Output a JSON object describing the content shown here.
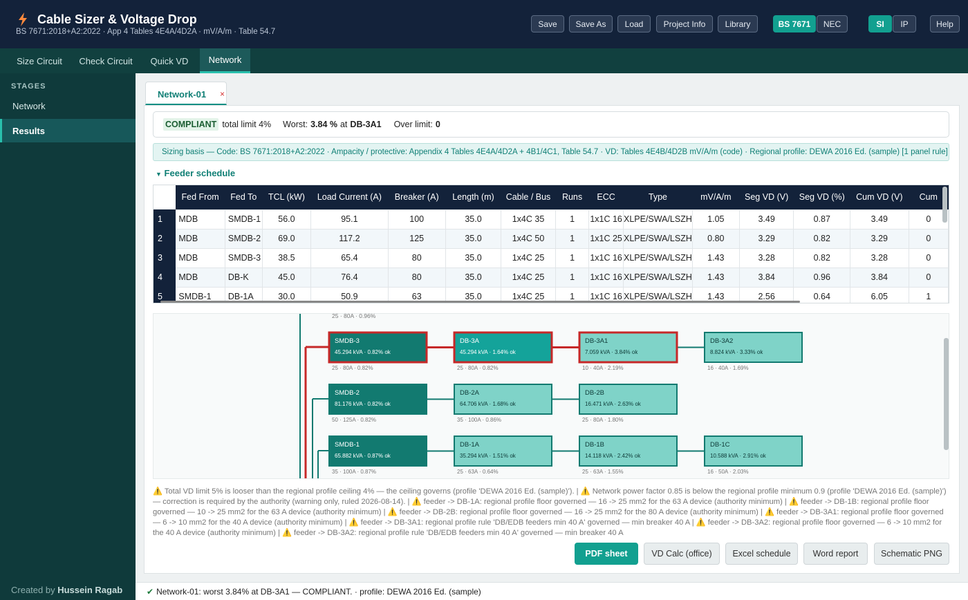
{
  "app": {
    "title": "Cable Sizer & Voltage Drop",
    "subtitle": "BS 7671:2018+A2:2022  ·  App 4 Tables 4E4A/4D2A  ·  mV/A/m  ·  Table 54.7",
    "accent_color": "#12a090",
    "logo_icon": "lightning-icon"
  },
  "toolbar": {
    "save": "Save",
    "save_as": "Save As",
    "load": "Load",
    "project_info": "Project Info",
    "library": "Library",
    "std_bs": "BS 7671",
    "std_nec": "NEC",
    "unit_si": "SI",
    "unit_ip": "IP",
    "help": "Help",
    "selected_standard": "BS 7671",
    "selected_units": "SI"
  },
  "nav_tabs": [
    "Size Circuit",
    "Check Circuit",
    "Quick VD",
    "Network"
  ],
  "active_tab": "Network",
  "sidebar": {
    "heading": "STAGES",
    "items": [
      "Network",
      "Results"
    ],
    "active": "Results",
    "credit_prefix": "Created by",
    "credit_name": "Hussein Ragab"
  },
  "doc_tab": {
    "label": "Network-01",
    "close": "×"
  },
  "summary": {
    "badge": "COMPLIANT",
    "limit": "total limit 4%",
    "worst_label": "Worst:",
    "worst_value": "3.84 %",
    "worst_at": "at",
    "worst_node": "DB-3A1",
    "over_label": "Over limit:",
    "over_value": "0"
  },
  "sizing_basis": "Sizing basis —  Code: BS 7671:2018+A2:2022   ·   Ampacity / protective: Appendix 4 Tables 4E4A/4D2A + 4B1/4C1, Table 54.7   ·   VD: Tables 4E4B/4D2B mV/A/m (code)   ·   Regional profile: DEWA 2016 Ed. (sample) [1 panel rule]",
  "feeder_schedule": {
    "heading": "Feeder schedule",
    "columns": [
      "Fed From",
      "Fed To",
      "TCL (kW)",
      "Load Current (A)",
      "Breaker (A)",
      "Length (m)",
      "Cable / Bus",
      "Runs",
      "ECC",
      "Type",
      "mV/A/m",
      "Seg VD (V)",
      "Seg VD (%)",
      "Cum VD (V)",
      "Cum"
    ],
    "rows": [
      [
        "1",
        "MDB",
        "SMDB-1",
        "56.0",
        "95.1",
        "100",
        "35.0",
        "1x4C 35",
        "1",
        "1x1C 16",
        "XLPE/SWA/LSZH",
        "1.05",
        "3.49",
        "0.87",
        "3.49",
        "0"
      ],
      [
        "2",
        "MDB",
        "SMDB-2",
        "69.0",
        "117.2",
        "125",
        "35.0",
        "1x4C 50",
        "1",
        "1x1C 25",
        "XLPE/SWA/LSZH",
        "0.80",
        "3.29",
        "0.82",
        "3.29",
        "0"
      ],
      [
        "3",
        "MDB",
        "SMDB-3",
        "38.5",
        "65.4",
        "80",
        "35.0",
        "1x4C 25",
        "1",
        "1x1C 16",
        "XLPE/SWA/LSZH",
        "1.43",
        "3.28",
        "0.82",
        "3.28",
        "0"
      ],
      [
        "4",
        "MDB",
        "DB-K",
        "45.0",
        "76.4",
        "80",
        "35.0",
        "1x4C 25",
        "1",
        "1x1C 16",
        "XLPE/SWA/LSZH",
        "1.43",
        "3.84",
        "0.96",
        "3.84",
        "0"
      ],
      [
        "5",
        "SMDB-1",
        "DB-1A",
        "30.0",
        "50.9",
        "63",
        "35.0",
        "1x4C 25",
        "1",
        "1x1C 16",
        "XLPE/SWA/LSZH",
        "1.43",
        "2.56",
        "0.64",
        "6.05",
        "1"
      ]
    ]
  },
  "diagram": {
    "top_label": "25 · 80A · 0.96%",
    "nodes": [
      {
        "name": "SMDB-3",
        "info": "45.294 kVA · 0.82% ok",
        "foot": "25 · 80A · 0.82%",
        "style": "dark",
        "critical": true
      },
      {
        "name": "DB-3A",
        "info": "45.294 kVA · 1.64% ok",
        "foot": "25 · 80A · 0.82%",
        "style": "mid",
        "critical": true
      },
      {
        "name": "DB-3A1",
        "info": "7.059 kVA · 3.84% ok",
        "foot": "10 · 40A · 2.19%",
        "style": "light",
        "critical": true
      },
      {
        "name": "DB-3A2",
        "info": "8.824 kVA · 3.33% ok",
        "foot": "16 · 40A · 1.69%",
        "style": "light",
        "critical": false
      },
      {
        "name": "SMDB-2",
        "info": "81.176 kVA · 0.82% ok",
        "foot": "50 · 125A · 0.82%",
        "style": "dark",
        "critical": false
      },
      {
        "name": "DB-2A",
        "info": "64.706 kVA · 1.68% ok",
        "foot": "35 · 100A · 0.86%",
        "style": "light",
        "critical": false
      },
      {
        "name": "DB-2B",
        "info": "16.471 kVA · 2.63% ok",
        "foot": "25 · 80A · 1.80%",
        "style": "light",
        "critical": false
      },
      {
        "name": "SMDB-1",
        "info": "65.882 kVA · 0.87% ok",
        "foot": "35 · 100A · 0.87%",
        "style": "dark",
        "critical": false
      },
      {
        "name": "DB-1A",
        "info": "35.294 kVA · 1.51% ok",
        "foot": "25 · 63A · 0.64%",
        "style": "light",
        "critical": false
      },
      {
        "name": "DB-1B",
        "info": "14.118 kVA · 2.42% ok",
        "foot": "25 · 63A · 1.55%",
        "style": "light",
        "critical": false
      },
      {
        "name": "DB-1C",
        "info": "10.588 kVA · 2.91% ok",
        "foot": "16 · 50A · 2.03%",
        "style": "light",
        "critical": false
      }
    ],
    "colors": {
      "dark": "#127a70",
      "mid": "#14a39a",
      "light": "#7fd3c8",
      "critical": "#c62828",
      "link": "#127a70"
    }
  },
  "warnings_text": "⚠️ Total VD limit 5% is looser than the regional profile ceiling 4% — the ceiling governs (profile 'DEWA 2016 Ed. (sample)').  |  ⚠️ Network power factor 0.85 is below the regional profile minimum 0.9 (profile 'DEWA 2016 Ed. (sample)') — correction is required by the authority (warning only, ruled 2026-08-14).  |  ⚠️ feeder -> DB-1A: regional profile floor governed — 16 -> 25 mm2 for the 63 A device (authority minimum)  |  ⚠️ feeder -> DB-1B: regional profile floor governed — 10 -> 25 mm2 for the 63 A device (authority minimum)  |  ⚠️ feeder -> DB-2B: regional profile floor governed — 16 -> 25 mm2 for the 80 A device (authority minimum)  |  ⚠️ feeder -> DB-3A1: regional profile floor governed — 6 -> 10 mm2 for the 40 A device (authority minimum)  |  ⚠️ feeder -> DB-3A1: regional profile rule 'DB/EDB feeders min 40 A' governed — min breaker 40 A  |  ⚠️ feeder -> DB-3A2: regional profile floor governed — 6 -> 10 mm2 for the 40 A device (authority minimum)  |  ⚠️ feeder -> DB-3A2: regional profile rule 'DB/EDB feeders min 40 A' governed — min breaker 40 A",
  "actions": {
    "pdf": "PDF sheet",
    "vd_calc": "VD Calc (office)",
    "excel": "Excel schedule",
    "word": "Word report",
    "schematic": "Schematic PNG"
  },
  "status_line": "Network-01: worst 3.84% at DB-3A1 — COMPLIANT.   ·  profile: DEWA 2016 Ed. (sample)"
}
